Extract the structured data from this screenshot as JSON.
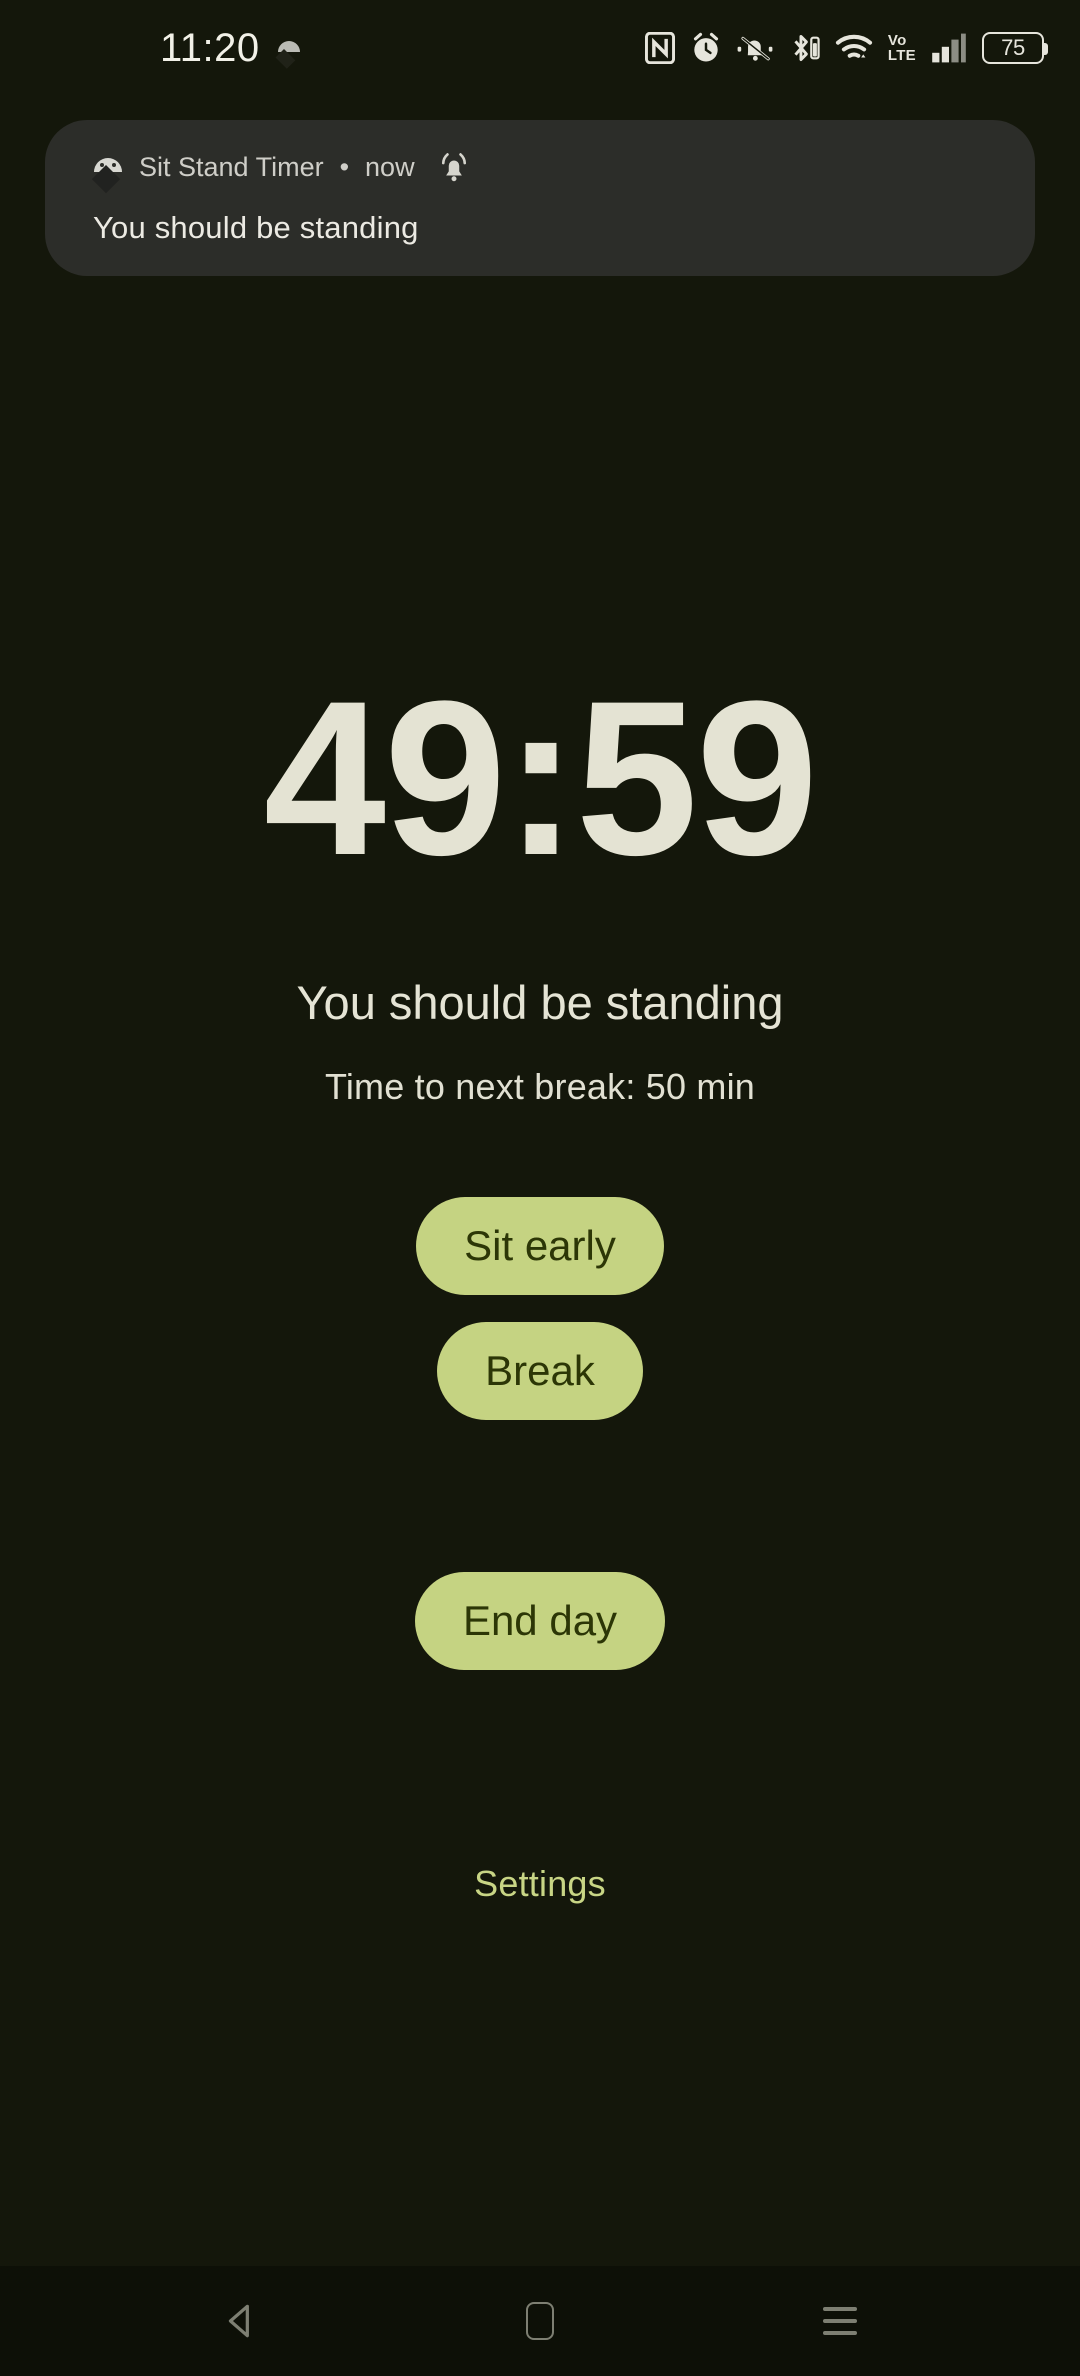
{
  "status_bar": {
    "clock": "11:20",
    "icons": [
      {
        "name": "nfc-icon",
        "label": "NFC"
      },
      {
        "name": "alarm-icon",
        "label": "Alarm"
      },
      {
        "name": "mute-bell-icon",
        "label": "Silent"
      },
      {
        "name": "bluetooth-battery-icon",
        "label": "Bluetooth"
      },
      {
        "name": "wifi-icon",
        "label": "Wi-Fi"
      },
      {
        "name": "volte-icon",
        "label": "VoLTE"
      },
      {
        "name": "signal-bars-icon",
        "label": "Signal"
      },
      {
        "name": "battery-icon",
        "label": "Battery"
      }
    ],
    "volte_top": "Vo",
    "volte_bottom": "LTE",
    "battery_level": "75"
  },
  "notification": {
    "app_name": "Sit Stand Timer",
    "separator": "•",
    "time": "now",
    "body": "You should be standing",
    "alert_icon": "bell-ringing-icon"
  },
  "main": {
    "timer": "49:59",
    "status_line": "You should be standing",
    "subtitle": "Time to next break: 50 min",
    "buttons": [
      {
        "id": "sit-early",
        "label": "Sit early"
      },
      {
        "id": "break",
        "label": "Break"
      },
      {
        "id": "end-day",
        "label": "End day"
      }
    ],
    "settings_label": "Settings"
  },
  "nav_bar": {
    "back_label": "Back",
    "home_label": "Home",
    "recents_label": "Recents"
  },
  "colors": {
    "background": "#14170b",
    "accent": "#c5d382",
    "accent_text": "#2c3606",
    "timer_text": "#e4e3d3",
    "notification_bg": "#2c2d29",
    "nav_bg": "#0d1007"
  }
}
